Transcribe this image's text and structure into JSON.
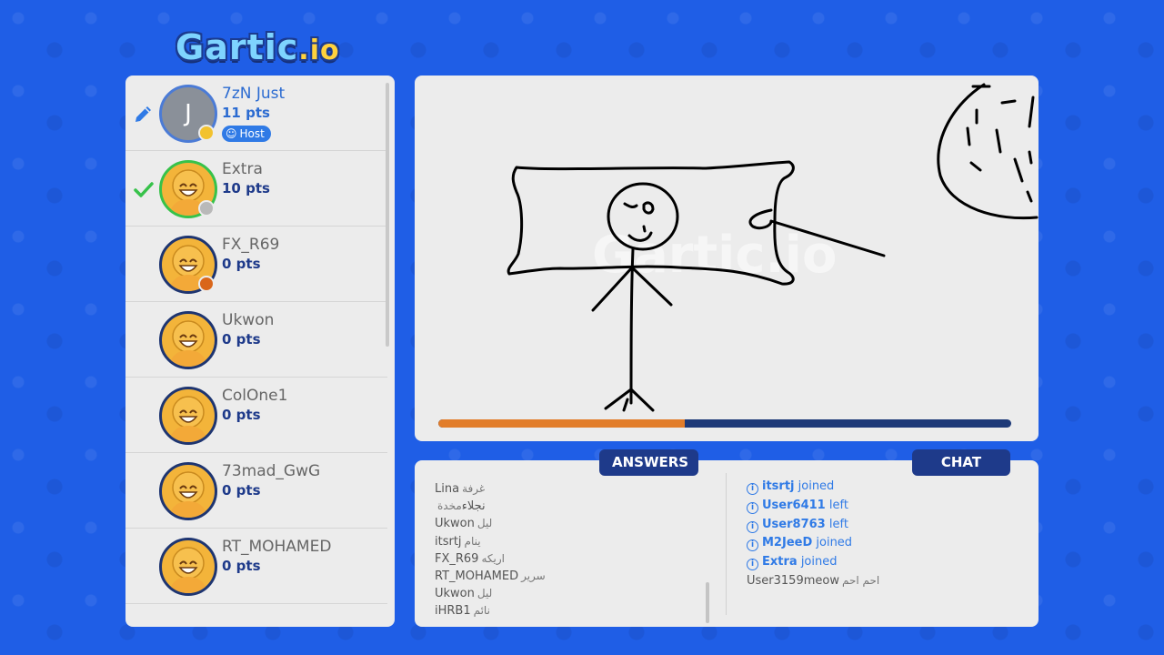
{
  "logo": {
    "text": "Gartic",
    "suffix": ".io"
  },
  "players": [
    {
      "name": "7zN Just",
      "pts": "11 pts",
      "state": "drawing",
      "host": true,
      "initial": "J",
      "status_color": "#f2c22e",
      "badge": "Host"
    },
    {
      "name": "Extra",
      "pts": "10 pts",
      "state": "guessed",
      "host": false,
      "status_color": "#b9b9b9"
    },
    {
      "name": "FX_R69",
      "pts": "0 pts",
      "state": "",
      "host": false,
      "status_color": "#d9661a"
    },
    {
      "name": "Ukwon",
      "pts": "0 pts",
      "state": "",
      "host": false
    },
    {
      "name": "ColOne1",
      "pts": "0 pts",
      "state": "",
      "host": false
    },
    {
      "name": "73mad_GwG",
      "pts": "0 pts",
      "state": "",
      "host": false
    },
    {
      "name": "RT_MOHAMED",
      "pts": "0 pts",
      "state": "",
      "host": false
    }
  ],
  "canvas": {
    "watermark": "Gartic.io",
    "timer_fraction": 0.43
  },
  "tabs": {
    "answers": "ANSWERS",
    "chat": "CHAT"
  },
  "answers": [
    {
      "user": "Lina",
      "guess": "غرفة"
    },
    {
      "user": "نجلاء",
      "guess": "مخدة"
    },
    {
      "user": "Ukwon",
      "guess": "ليل"
    },
    {
      "user": "itsrtj",
      "guess": "ينام"
    },
    {
      "user": "FX_R69",
      "guess": "اريكه"
    },
    {
      "user": "RT_MOHAMED",
      "guess": "سرير"
    },
    {
      "user": "Ukwon",
      "guess": "ليل"
    },
    {
      "user": "iHRB1",
      "guess": "نائم"
    }
  ],
  "chat": [
    {
      "user": "itsrtj",
      "action": "joined",
      "system": true
    },
    {
      "user": "User6411",
      "action": "left",
      "system": true
    },
    {
      "user": "User8763",
      "action": "left",
      "system": true
    },
    {
      "user": "M2JeeD",
      "action": "joined",
      "system": true
    },
    {
      "user": "Extra",
      "action": "joined",
      "system": true
    },
    {
      "user": "User3159meow",
      "message": "احم احم",
      "system": false
    }
  ],
  "colors": {
    "accent": "#2f7ae6",
    "navy": "#1e3a8a",
    "timer": "#e27d2a",
    "background": "#1f5ee6"
  }
}
